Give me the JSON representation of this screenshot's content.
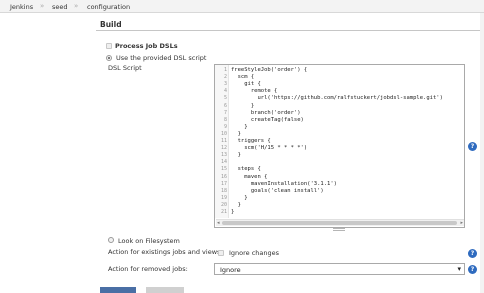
{
  "breadcrumbs": [
    {
      "label": "Jenkins"
    },
    {
      "label": "seed"
    },
    {
      "label": "configuration"
    }
  ],
  "breadcrumb_separator": "»",
  "section": {
    "title": "Build"
  },
  "process_job_dsls": {
    "label": "Process Job DSLs",
    "checked": false
  },
  "use_provided_script": {
    "label": "Use the provided DSL script",
    "selected": true
  },
  "dsl_script": {
    "label": "DSL Script",
    "line_numbers": [
      "1",
      "2",
      "3",
      "4",
      "5",
      "6",
      "7",
      "8",
      "9",
      "10",
      "11",
      "12",
      "13",
      "14",
      "15",
      "16",
      "17",
      "18",
      "19",
      "20",
      "21"
    ],
    "lines": [
      "freeStyleJob('order') {",
      "  scm {",
      "    git {",
      "      remote {",
      "        url('https://github.com/ralfstuckert/jobdsl-sample.git')",
      "      }",
      "      branch('order')",
      "      createTag(false)",
      "    }",
      "  }",
      "  triggers {",
      "    scm('H/15 * * * *')",
      "  }",
      "",
      "  steps {",
      "    maven {",
      "      mavenInstallation('3.1.1')",
      "      goals('clean install')",
      "    }",
      "  }",
      "}"
    ]
  },
  "look_on_filesystem": {
    "label": "Look on Filesystem",
    "selected": false
  },
  "existing_jobs": {
    "label": "Action for existings jobs and views:",
    "ignore_label": "Ignore changes",
    "checked": false
  },
  "removed_jobs": {
    "label": "Action for removed jobs:",
    "selected_value": "Ignore"
  },
  "icons": {
    "help": "help-icon",
    "dropdown": "chevron-down-icon"
  },
  "colors": {
    "help_blue": "#2f6bbf",
    "button_blue": "#4a6fa5"
  }
}
